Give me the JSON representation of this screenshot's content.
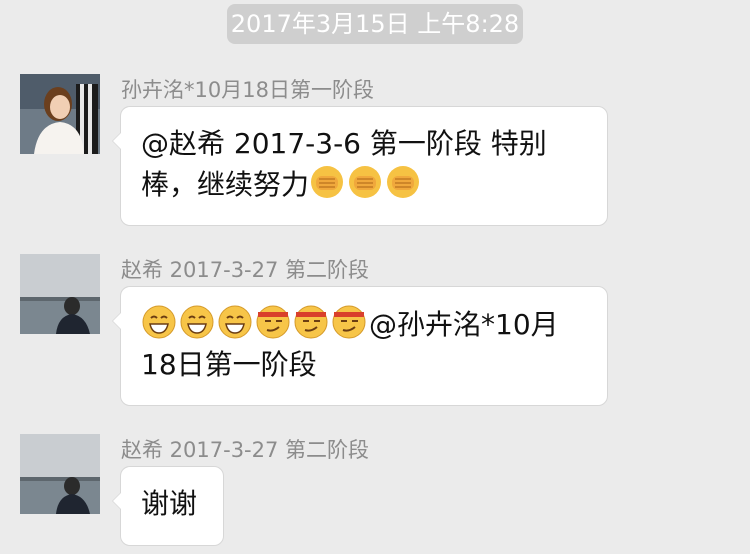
{
  "timestamp": "2017年3月15日 上午8:28",
  "messages": [
    {
      "sender": "孙卉洺*10月18日第一阶段",
      "line1": "@赵希 2017-3-6 第一阶段 特别",
      "line2": "棒，继续努力",
      "emojis_after": [
        "fist-bump-emoji",
        "fist-bump-emoji",
        "fist-bump-emoji"
      ]
    },
    {
      "sender": "赵希 2017-3-27 第二阶段",
      "emojis_before": [
        "grin-emoji",
        "grin-emoji",
        "grin-emoji",
        "smirk-headband-emoji",
        "smirk-headband-emoji",
        "smirk-headband-emoji"
      ],
      "line1": "@孙卉洺*10月",
      "line2": "18日第一阶段"
    },
    {
      "sender": "赵希 2017-3-27 第二阶段",
      "line1": "谢谢"
    }
  ]
}
